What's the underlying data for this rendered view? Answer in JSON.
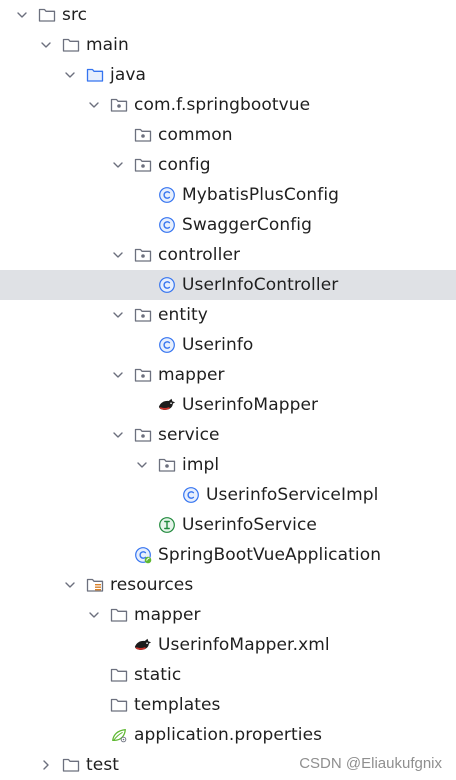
{
  "tree": [
    {
      "label": "src",
      "depth": 0,
      "expand": "open",
      "icon": "folder"
    },
    {
      "label": "main",
      "depth": 1,
      "expand": "open",
      "icon": "folder"
    },
    {
      "label": "java",
      "depth": 2,
      "expand": "open",
      "icon": "source-folder"
    },
    {
      "label": "com.f.springbootvue",
      "depth": 3,
      "expand": "open",
      "icon": "package"
    },
    {
      "label": "common",
      "depth": 4,
      "expand": "none",
      "icon": "package"
    },
    {
      "label": "config",
      "depth": 4,
      "expand": "open",
      "icon": "package"
    },
    {
      "label": "MybatisPlusConfig",
      "depth": 5,
      "expand": "none",
      "icon": "class"
    },
    {
      "label": "SwaggerConfig",
      "depth": 5,
      "expand": "none",
      "icon": "class"
    },
    {
      "label": "controller",
      "depth": 4,
      "expand": "open",
      "icon": "package"
    },
    {
      "label": "UserInfoController",
      "depth": 5,
      "expand": "none",
      "icon": "class",
      "selected": true
    },
    {
      "label": "entity",
      "depth": 4,
      "expand": "open",
      "icon": "package"
    },
    {
      "label": "Userinfo",
      "depth": 5,
      "expand": "none",
      "icon": "class"
    },
    {
      "label": "mapper",
      "depth": 4,
      "expand": "open",
      "icon": "package"
    },
    {
      "label": "UserinfoMapper",
      "depth": 5,
      "expand": "none",
      "icon": "mybatis"
    },
    {
      "label": "service",
      "depth": 4,
      "expand": "open",
      "icon": "package"
    },
    {
      "label": "impl",
      "depth": 5,
      "expand": "open",
      "icon": "package"
    },
    {
      "label": "UserinfoServiceImpl",
      "depth": 6,
      "expand": "none",
      "icon": "class"
    },
    {
      "label": "UserinfoService",
      "depth": 5,
      "expand": "none",
      "icon": "interface"
    },
    {
      "label": "SpringBootVueApplication",
      "depth": 4,
      "expand": "none",
      "icon": "spring-class"
    },
    {
      "label": "resources",
      "depth": 2,
      "expand": "open",
      "icon": "resources-folder"
    },
    {
      "label": "mapper",
      "depth": 3,
      "expand": "open",
      "icon": "folder"
    },
    {
      "label": "UserinfoMapper.xml",
      "depth": 4,
      "expand": "none",
      "icon": "mybatis"
    },
    {
      "label": "static",
      "depth": 3,
      "expand": "none",
      "icon": "folder"
    },
    {
      "label": "templates",
      "depth": 3,
      "expand": "none",
      "icon": "folder"
    },
    {
      "label": "application.properties",
      "depth": 3,
      "expand": "none",
      "icon": "spring-properties"
    },
    {
      "label": "test",
      "depth": 1,
      "expand": "closed",
      "icon": "folder"
    }
  ],
  "watermark": "CSDN @Eliaukufgnix",
  "colors": {
    "selected_bg": "#dfe1e5",
    "class_icon": "#3574f0",
    "interface_icon": "#208a3c",
    "spring_icon": "#5fb832",
    "folder_stroke": "#6c707e",
    "source_folder": "#3574f0"
  }
}
